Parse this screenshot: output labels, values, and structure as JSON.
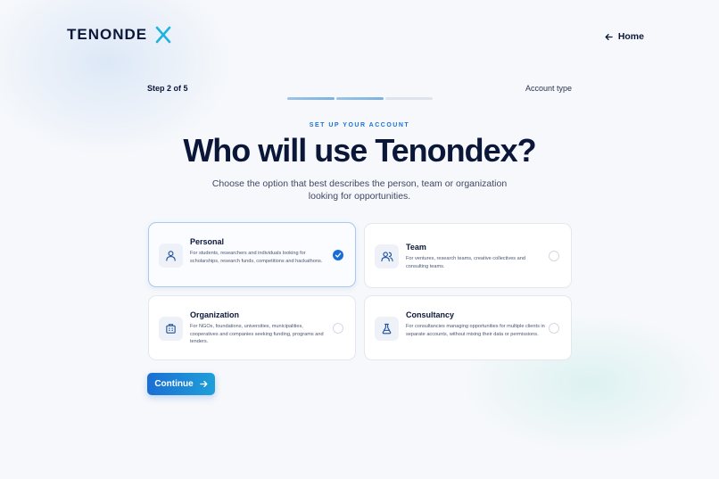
{
  "brand": {
    "name": "TENONDE",
    "accent": "#1fb3e0"
  },
  "nav": {
    "home_label": "Home"
  },
  "progress": {
    "step_label": "Step 2 of 5",
    "current_step": 2,
    "total_steps": 5,
    "section_label": "Account type"
  },
  "header": {
    "eyebrow": "SET UP YOUR ACCOUNT",
    "title": "Who will use Tenondex?",
    "subtitle": "Choose the option that best describes the person, team or organization looking for opportunities."
  },
  "options": [
    {
      "title": "Personal",
      "description": "For students, researchers and individuals looking for scholarships, research funds, competitions and hackathons.",
      "icon": "person-icon",
      "selected": true
    },
    {
      "title": "Team",
      "description": "For ventures, research teams, creative collectives and consulting teams.",
      "icon": "team-icon",
      "selected": false
    },
    {
      "title": "Organization",
      "description": "For NGOs, foundations, universities, municipalities, cooperatives and companies seeking funding, programs and tenders.",
      "icon": "building-icon",
      "selected": false
    },
    {
      "title": "Consultancy",
      "description": "For consultancies managing opportunities for multiple clients in separate accounts, without mixing their data or permissions.",
      "icon": "flask-icon",
      "selected": false
    }
  ],
  "actions": {
    "continue_label": "Continue"
  },
  "colors": {
    "primary": "#1a6fd4",
    "text": "#0b1738"
  }
}
